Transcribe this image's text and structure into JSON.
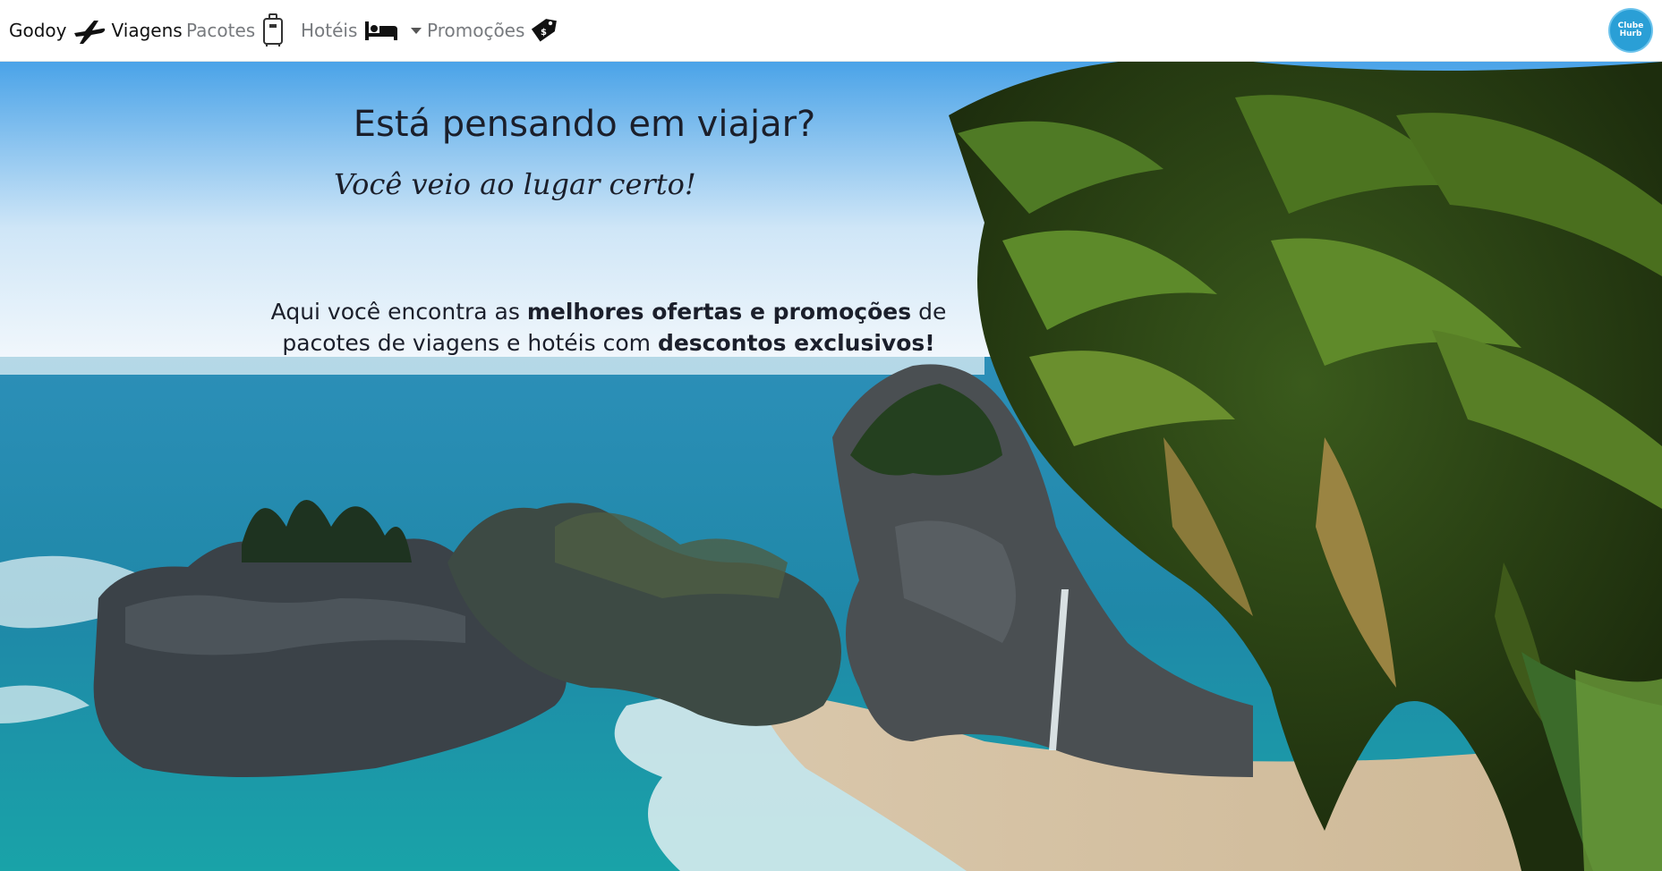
{
  "navbar": {
    "brand_left": "Godoy",
    "brand_right": "Viagens",
    "links": {
      "pacotes": "Pacotes",
      "hoteis": "Hotéis",
      "promocoes": "Promoções"
    },
    "avatar_line1": "Clube",
    "avatar_line2": "Hurb"
  },
  "hero": {
    "title": "Está pensando em viajar?",
    "subtitle": "Você veio ao lugar certo!",
    "text_part1": "Aqui você encontra as ",
    "text_bold1": "melhores ofertas e promoções",
    "text_part2": " de pacotes de viagens e hotéis com ",
    "text_bold2": "descontos exclusivos!"
  },
  "colors": {
    "sky_top": "#4aa3e8",
    "sea": "#1f8fb0",
    "avatar": "#2a9fd6"
  }
}
